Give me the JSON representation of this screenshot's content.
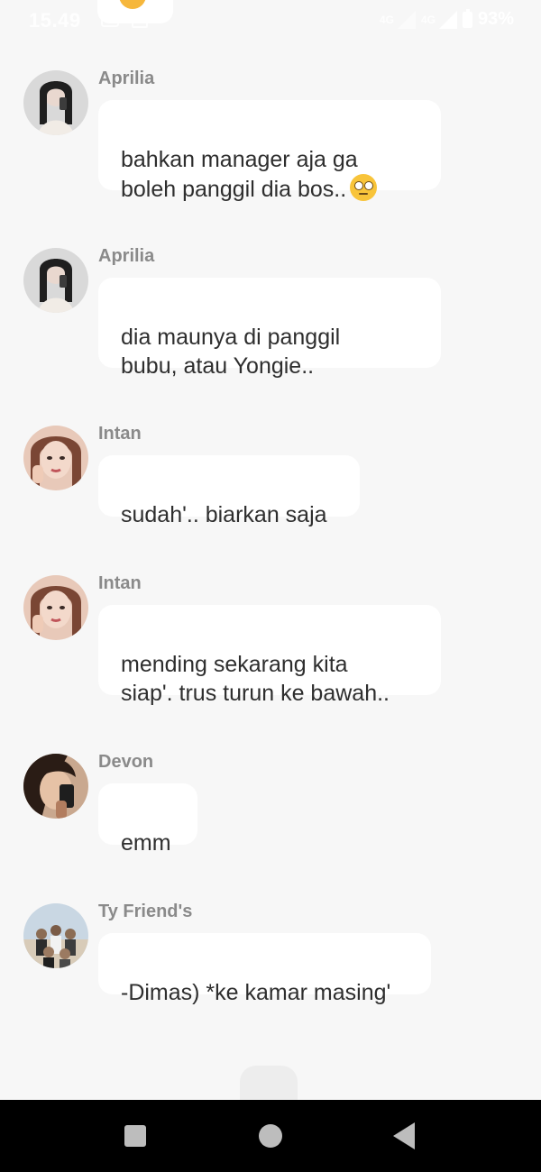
{
  "status_bar": {
    "time": "15.49",
    "network_1": "4G",
    "network_2": "4G",
    "battery": "93%",
    "icons": [
      "notification-icon",
      "notification-icon",
      "signal-icon",
      "signal-icon",
      "battery-icon"
    ]
  },
  "messages": [
    {
      "sender": "Aprilia",
      "text": "bahkan manager aja ga\nboleh panggil dia bos..",
      "emoji": "face-with-rolling-eyes",
      "avatar_colors": [
        "#4a4a4a",
        "#e9e2dc",
        "#1f1f1f"
      ]
    },
    {
      "sender": "Aprilia",
      "text": "dia maunya di panggil\nbubu, atau Yongie..",
      "avatar_colors": [
        "#4a4a4a",
        "#e9e2dc",
        "#1f1f1f"
      ]
    },
    {
      "sender": "Intan",
      "text": "sudah'.. biarkan saja",
      "avatar_colors": [
        "#b57a62",
        "#f1d5c7",
        "#6b3b2a"
      ]
    },
    {
      "sender": "Intan",
      "text": "mending sekarang kita\nsiap'.  trus turun ke bawah..",
      "avatar_colors": [
        "#b57a62",
        "#f1d5c7",
        "#6b3b2a"
      ]
    },
    {
      "sender": "Devon",
      "text": "emm",
      "avatar_colors": [
        "#6e4c3a",
        "#caa58b",
        "#2a1c15"
      ]
    },
    {
      "sender": "Ty Friend's",
      "text": "-Dimas) *ke kamar masing'",
      "avatar_colors": [
        "#c9d7e3",
        "#8b6d55",
        "#2c2c2c"
      ]
    }
  ],
  "nav_bar": {
    "recents": "recents-icon",
    "home": "home-icon",
    "back": "back-icon"
  },
  "colors": {
    "background": "#f7f7f7",
    "bubble": "#ffffff",
    "sender_text": "#8a8a8a",
    "message_text": "#2e2e2e",
    "nav_bar": "#000000"
  }
}
